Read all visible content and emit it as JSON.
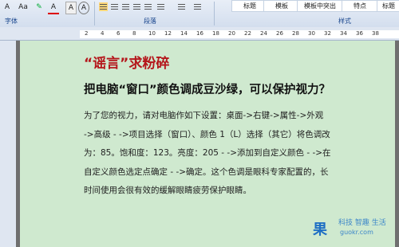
{
  "ribbon": {
    "font_group_label": "字体",
    "paragraph_group_label": "段落",
    "style_group_label": "样式",
    "font_size_label": "A",
    "aa_label": "Aa",
    "styles": [
      "标题",
      "模板",
      "模板中突出",
      "特点",
      "标题"
    ]
  },
  "ruler": {
    "numbers": [
      "2",
      "4",
      "6",
      "8",
      "10",
      "12",
      "14",
      "16",
      "18",
      "20",
      "22",
      "24",
      "26",
      "28",
      "30",
      "32",
      "34",
      "36",
      "38"
    ]
  },
  "document": {
    "heading1": "“谣言”求粉碎",
    "heading2": "把电脑“窗口”颜色调成豆沙绿，可以保护视力？",
    "body_lines": [
      "为了您的视力，请对电脑作如下设置：桌面->右键->属性->外观",
      "->高级 - ->项目选择（窗口）、颜色 1（L）选择（其它）将色调改",
      "为：85。饱和度：123。亮度：205 - ->添加到自定义颜色 - ->在",
      "自定义颜色选定点确定 - ->确定。这个色调是眼科专家配置的，长",
      "时间使用会很有效的缓解眼睛疲劳保护眼睛。"
    ]
  },
  "watermark": {
    "logo": "果",
    "tagline": "科技  智趣  生活",
    "url": "guokr.com"
  },
  "colors": {
    "page_background": "#cfe9cf",
    "heading1": "#b5171c",
    "watermark": "#1f6fc4"
  }
}
